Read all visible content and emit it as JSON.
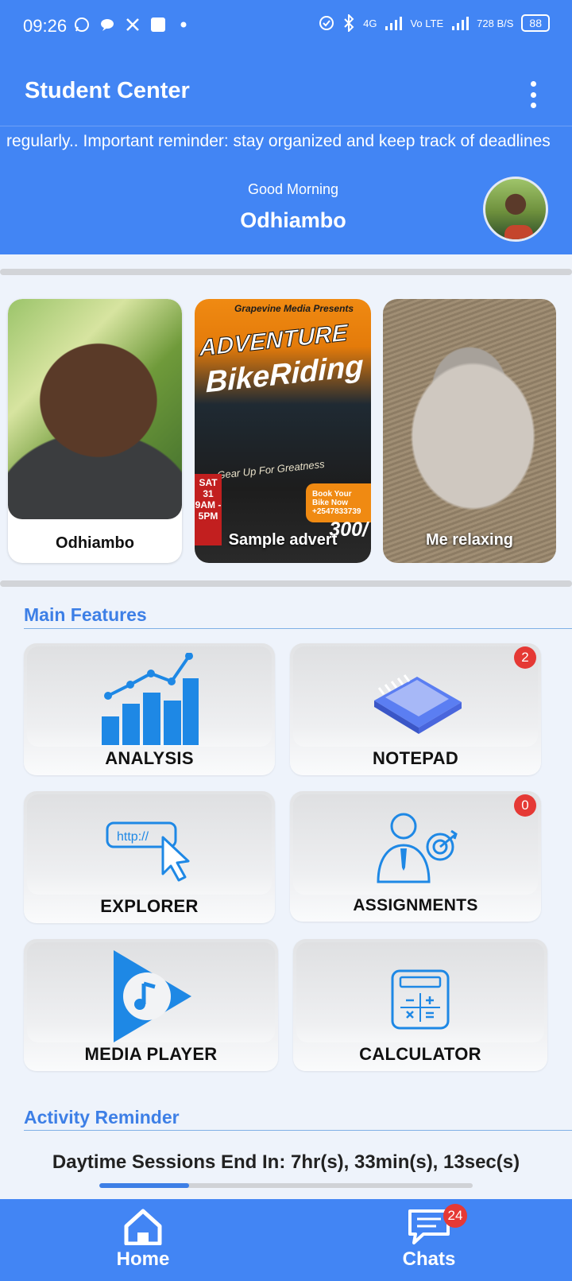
{
  "status_bar": {
    "time": "09:26",
    "network_type": "4G",
    "volte": "Vo LTE",
    "speed": "728 B/S",
    "battery": "88"
  },
  "app_bar": {
    "title": "Student Center"
  },
  "ticker": {
    "text": "regularly.. Important reminder: stay organized and keep track of deadlines"
  },
  "greeting": {
    "salutation": "Good Morning",
    "name": "Odhiambo"
  },
  "stories": [
    {
      "label": "Odhiambo"
    },
    {
      "label": "Sample advert",
      "poster": {
        "top": "Grapevine Media Presents",
        "title_line1": "ADVENTURE",
        "title_line2": "BikeRiding",
        "tagline": "Gear Up For Greatness",
        "book": "Book Your Bike Now +2547833739",
        "date": "SAT 31 9AM - 5PM",
        "price": "300/"
      }
    },
    {
      "label": "Me relaxing"
    }
  ],
  "main_features": {
    "title": "Main Features",
    "items": [
      {
        "label": "ANALYSIS",
        "icon": "bar-chart-icon"
      },
      {
        "label": "NOTEPAD",
        "icon": "notepad-icon",
        "badge": "2"
      },
      {
        "label": "EXPLORER",
        "icon": "browser-icon"
      },
      {
        "label": "ASSIGNMENTS",
        "icon": "target-person-icon",
        "badge": "0"
      },
      {
        "label": "MEDIA PLAYER",
        "icon": "music-play-icon"
      },
      {
        "label": "CALCULATOR",
        "icon": "calculator-icon"
      }
    ]
  },
  "activity": {
    "title": "Activity Reminder",
    "timer_text": "Daytime Sessions End In: 7hr(s), 33min(s), 13sec(s)",
    "progress_fraction": 0.24
  },
  "bottom_nav": {
    "home_label": "Home",
    "chats_label": "Chats",
    "chats_badge": "24"
  },
  "colors": {
    "primary": "#4285f4",
    "accent": "#3d7fe6",
    "badge": "#e53935"
  }
}
